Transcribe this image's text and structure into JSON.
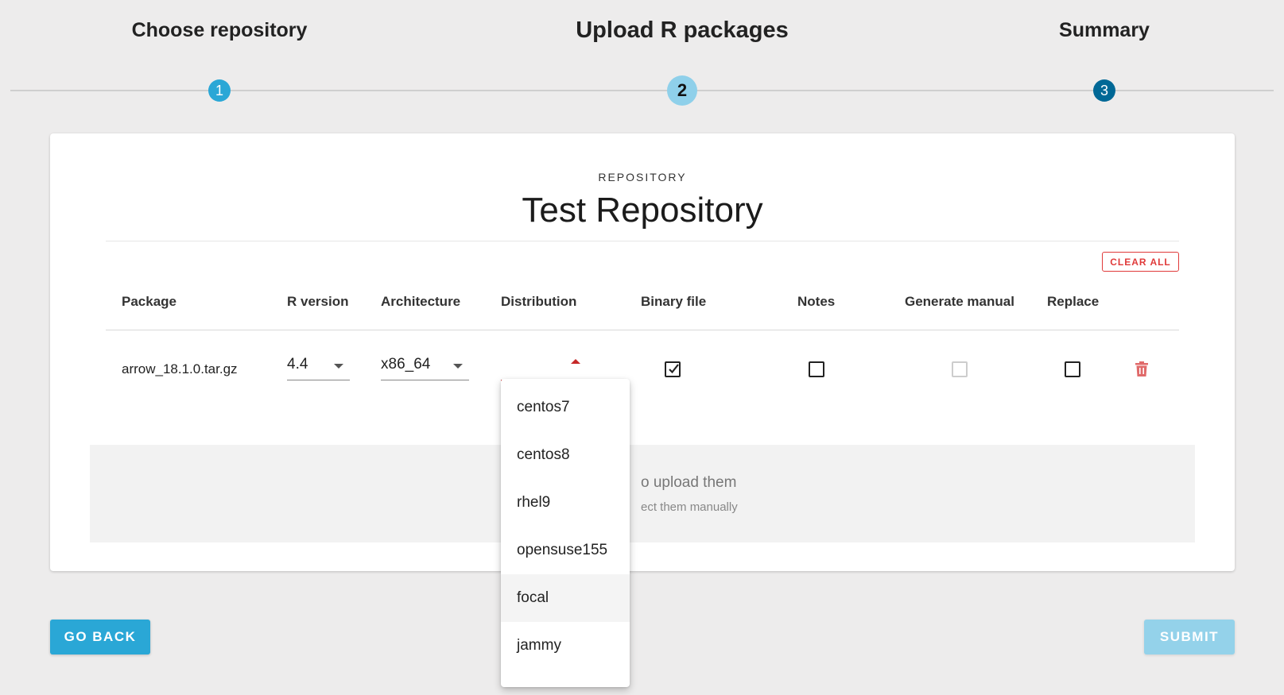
{
  "stepper": {
    "steps": [
      {
        "label": "Choose repository",
        "number": "1"
      },
      {
        "label": "Upload R packages",
        "number": "2"
      },
      {
        "label": "Summary",
        "number": "3"
      }
    ],
    "active_step": 2
  },
  "card": {
    "kicker": "REPOSITORY",
    "title": "Test Repository",
    "clear_all_label": "CLEAR ALL"
  },
  "table": {
    "headers": [
      "Package",
      "R version",
      "Architecture",
      "Distribution",
      "Binary file",
      "Notes",
      "Generate manual",
      "Replace"
    ],
    "rows": [
      {
        "package": "arrow_18.1.0.tar.gz",
        "r_version": "4.4",
        "architecture": "x86_64",
        "distribution": "",
        "binary_file": true,
        "notes": false,
        "generate_manual": false,
        "generate_manual_disabled": true,
        "replace": false
      }
    ]
  },
  "dropzone": {
    "main_text": "o upload them",
    "sub_text": "ect them manually"
  },
  "distribution_menu": {
    "options": [
      "centos7",
      "centos8",
      "rhel9",
      "opensuse155",
      "focal",
      "jammy"
    ],
    "highlighted": "focal"
  },
  "footer": {
    "back_label": "GO BACK",
    "submit_label": "SUBMIT"
  },
  "colors": {
    "primary": "#2aa7d6",
    "active_step": "#8fd0ea",
    "step3": "#006896",
    "danger": "#e03a3a",
    "submit_disabled": "#94d2ea"
  },
  "icons": [
    "checkmark-icon",
    "trash-icon",
    "caret-down-icon",
    "caret-up-icon"
  ]
}
